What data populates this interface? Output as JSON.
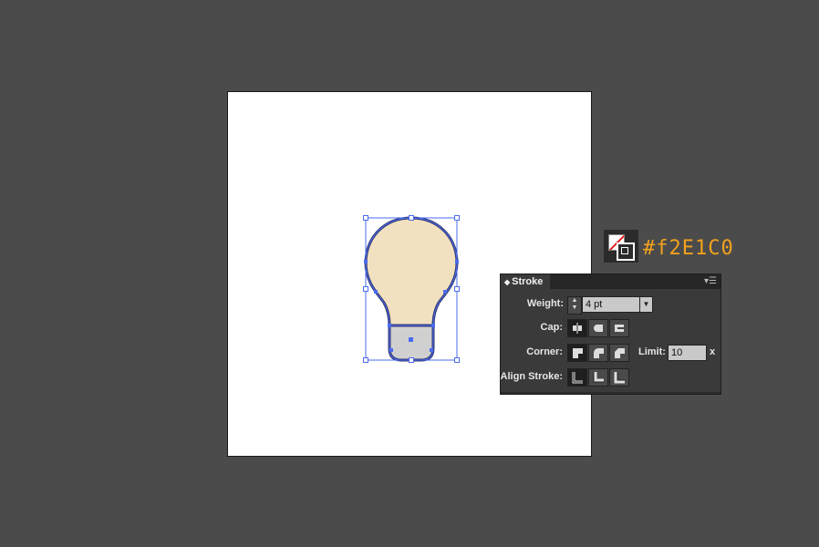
{
  "canvas": {
    "background": "#4b4b4b",
    "artboard_color": "#ffffff"
  },
  "bulb": {
    "fill_color": "#f2e1c0",
    "outline_color": "#30356b",
    "base_fill": "#d0d0d0",
    "selection_color": "#4a6cf0"
  },
  "swatch": {
    "fill": "none",
    "stroke": "white"
  },
  "annotation": {
    "hex_text": "#f2E1C0",
    "color": "#f2a21c"
  },
  "stroke_panel": {
    "title": "Stroke",
    "weight_label": "Weight:",
    "weight_value": "4 pt",
    "cap_label": "Cap:",
    "cap_options": [
      "butt-cap",
      "round-cap",
      "projecting-cap"
    ],
    "cap_selected": "butt-cap",
    "corner_label": "Corner:",
    "corner_options": [
      "miter-join",
      "round-join",
      "bevel-join"
    ],
    "corner_selected": "miter-join",
    "limit_label": "Limit:",
    "limit_value": "10",
    "limit_unit": "x",
    "align_label": "Align Stroke:",
    "align_options": [
      "align-center",
      "align-inside",
      "align-outside"
    ],
    "align_selected": "align-center"
  }
}
